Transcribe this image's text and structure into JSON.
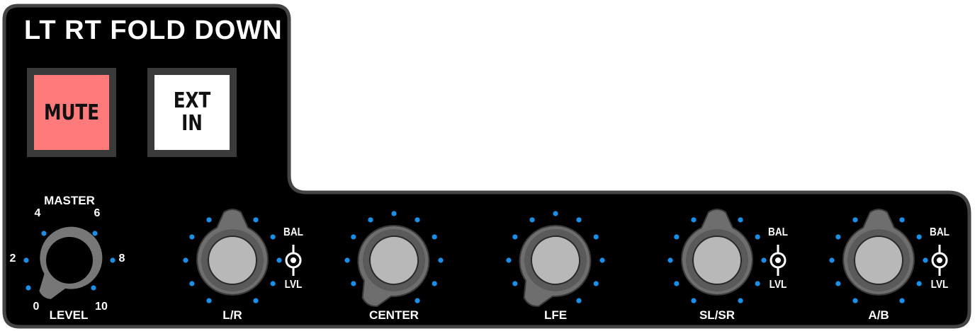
{
  "panel": {
    "title": "LT RT FOLD DOWN",
    "colors": {
      "panel": "#000000",
      "edge": "#444444",
      "led": "#1a8fe8",
      "mute_bg": "#ff7b7b",
      "ext_bg": "#ffffff"
    }
  },
  "buttons": {
    "mute": {
      "label": "MUTE"
    },
    "ext_in": {
      "line1": "EXT",
      "line2": "IN"
    }
  },
  "master": {
    "label_top": "MASTER",
    "label_bottom": "LEVEL",
    "scale": [
      "0",
      "2",
      "4",
      "6",
      "8",
      "10"
    ]
  },
  "knobs": [
    {
      "label": "L/R",
      "has_switch": true
    },
    {
      "label": "CENTER",
      "has_switch": false
    },
    {
      "label": "LFE",
      "has_switch": false
    },
    {
      "label": "SL/SR",
      "has_switch": true
    },
    {
      "label": "A/B",
      "has_switch": true
    }
  ],
  "switch": {
    "top": "BAL",
    "bottom": "LVL"
  }
}
